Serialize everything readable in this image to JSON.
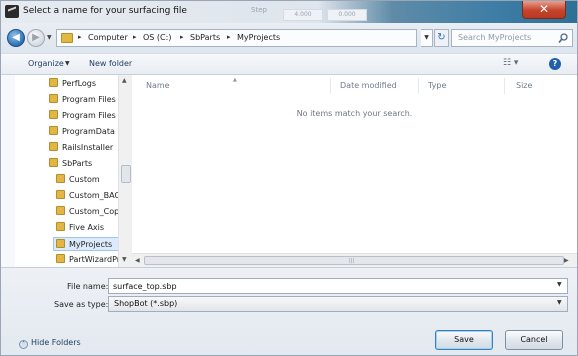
{
  "window": {
    "title": "Select a name for your surfacing file",
    "close_glyph": "✕"
  },
  "background_ghost": {
    "text1": "Step",
    "text2": "4.000",
    "text3": "0.000"
  },
  "address": {
    "crumbs": [
      "Computer",
      "OS (C:)",
      "SbParts",
      "MyProjects"
    ],
    "separator": "▸",
    "search_placeholder": "Search MyProjects"
  },
  "toolbar": {
    "organize_label": "Organize",
    "new_folder_label": "New folder"
  },
  "nav_tree": {
    "items": [
      {
        "label": "PerfLogs"
      },
      {
        "label": "Program Files"
      },
      {
        "label": "Program Files ("
      },
      {
        "label": "ProgramData"
      },
      {
        "label": "RailsInstaller"
      },
      {
        "label": "SbParts"
      },
      {
        "label": "Custom"
      },
      {
        "label": "Custom_BAC"
      },
      {
        "label": "Custom_Copy"
      },
      {
        "label": "Five Axis"
      },
      {
        "label": "MyProjects"
      },
      {
        "label": "PartWizardPr"
      }
    ],
    "selected": "MyProjects"
  },
  "file_list": {
    "columns": [
      "Name",
      "Date modified",
      "Type",
      "Size"
    ],
    "empty_message": "No items match your search."
  },
  "bottom": {
    "file_name_label": "File name:",
    "file_name_value": "surface_top.sbp",
    "save_as_type_label": "Save as type:",
    "save_as_type_value": "ShopBot (*.sbp)",
    "hide_folders_label": "Hide Folders",
    "save_label": "Save",
    "cancel_label": "Cancel"
  },
  "colors": {
    "accent": "#2b6fb4",
    "close_red": "#c5432b",
    "folder": "#e3b544",
    "selection": "#dcebfb"
  },
  "icons": [
    "app-icon",
    "back-arrow-icon",
    "forward-arrow-icon",
    "folder-icon",
    "refresh-icon",
    "search-icon",
    "views-icon",
    "help-icon",
    "close-icon",
    "chevron-down-icon"
  ]
}
